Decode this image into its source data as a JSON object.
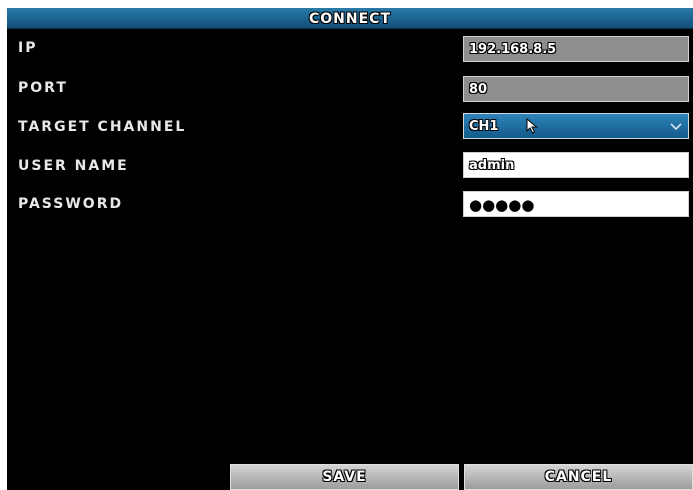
{
  "dialog": {
    "title": "CONNECT"
  },
  "fields": {
    "ip": {
      "label": "IP",
      "value": "192.168.8.5"
    },
    "port": {
      "label": "PORT",
      "value": "80"
    },
    "target_channel": {
      "label": "TARGET CHANNEL",
      "value": "CH1"
    },
    "user_name": {
      "label": "USER NAME",
      "value": "admin"
    },
    "password": {
      "label": "PASSWORD",
      "value": "●●●●●"
    }
  },
  "buttons": {
    "save": "SAVE",
    "cancel": "CANCEL"
  },
  "colors": {
    "title_bar": "#1a6394",
    "background": "#000000",
    "readonly_field": "#8e8e8e",
    "select_field": "#1f6fa3"
  },
  "icons": {
    "dropdown": "chevron-down-icon",
    "pointer": "mouse-cursor-icon"
  }
}
